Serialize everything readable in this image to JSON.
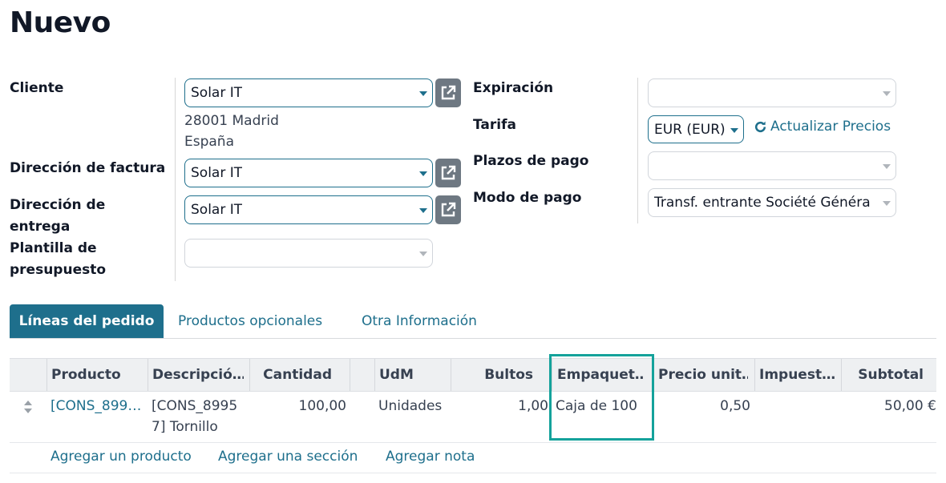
{
  "page": {
    "title": "Nuevo"
  },
  "left_form": {
    "cliente_label": "Cliente",
    "cliente_value": "Solar IT",
    "cliente_address_line1": "28001 Madrid",
    "cliente_address_line2": "España",
    "factura_label": "Dirección de factura",
    "factura_value": "Solar IT",
    "entrega_label_1": "Dirección de",
    "entrega_label_2": "entrega",
    "entrega_value": "Solar IT",
    "plantilla_label_1": "Plantilla de",
    "plantilla_label_2": "presupuesto",
    "plantilla_value": ""
  },
  "right_form": {
    "expiracion_label": "Expiración",
    "expiracion_value": "",
    "tarifa_label": "Tarifa",
    "tarifa_value": "EUR (EUR)",
    "actualizar_label": "Actualizar Precios",
    "plazos_label": "Plazos de pago",
    "plazos_value": "",
    "modo_label": "Modo de pago",
    "modo_value": "Transf. entrante Société Généra"
  },
  "tabs": [
    {
      "label": "Líneas del pedido",
      "active": true
    },
    {
      "label": "Productos opcionales",
      "active": false
    },
    {
      "label": "Otra Información",
      "active": false
    }
  ],
  "table": {
    "columns": [
      "Producto",
      "Descripció…",
      "Cantidad",
      "UdM",
      "Bultos",
      "Empaquet…",
      "Precio unit…",
      "Impuest…",
      "Subtotal"
    ],
    "rows": [
      {
        "producto": "[CONS_899…",
        "descripcion_1": "[CONS_8995",
        "descripcion_2": "7] Tornillo",
        "cantidad": "100,00",
        "udm": "Unidades",
        "bultos": "1,00",
        "empaquetado": "Caja de 100",
        "precio": "0,50",
        "impuestos": "",
        "subtotal": "50,00 €"
      }
    ],
    "add_links": [
      "Agregar un producto",
      "Agregar una sección",
      "Agregar nota"
    ]
  },
  "colors": {
    "accent": "#1e6f8c",
    "highlight": "#14a29b"
  }
}
